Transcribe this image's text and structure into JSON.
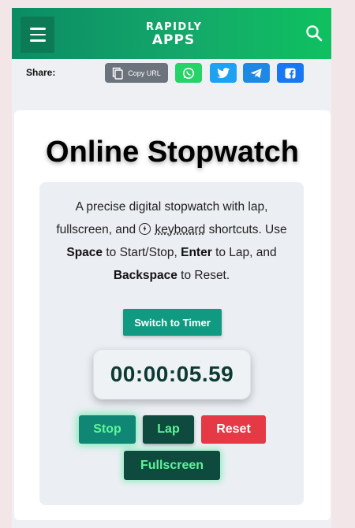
{
  "header": {
    "logo_line1": "RAPIDLY",
    "logo_line2": "APPS"
  },
  "share": {
    "label": "Share:",
    "copy_url_label": "Copy URL",
    "buttons": [
      "copy-icon",
      "whatsapp-icon",
      "twitter-icon",
      "telegram-icon",
      "facebook-icon"
    ]
  },
  "main": {
    "title": "Online Stopwatch",
    "desc_part1": "A precise digital stopwatch with lap, fullscreen, and",
    "desc_keyboard": "keyboard",
    "desc_part2": "shortcuts. Use",
    "key_space": "Space",
    "desc_part3": "to Start/Stop,",
    "key_enter": "Enter",
    "desc_part4": "to Lap, and",
    "key_backspace": "Backspace",
    "desc_part5": "to Reset.",
    "switch_label": "Switch to Timer",
    "time_display": "00:00:05.59",
    "stop_label": "Stop",
    "lap_label": "Lap",
    "reset_label": "Reset",
    "fullscreen_label": "Fullscreen"
  },
  "colors": {
    "header_gradient_start": "#0b8c64",
    "header_gradient_end": "#0fc160",
    "accent_green_text": "#5ff598",
    "reset_red": "#e63946"
  }
}
